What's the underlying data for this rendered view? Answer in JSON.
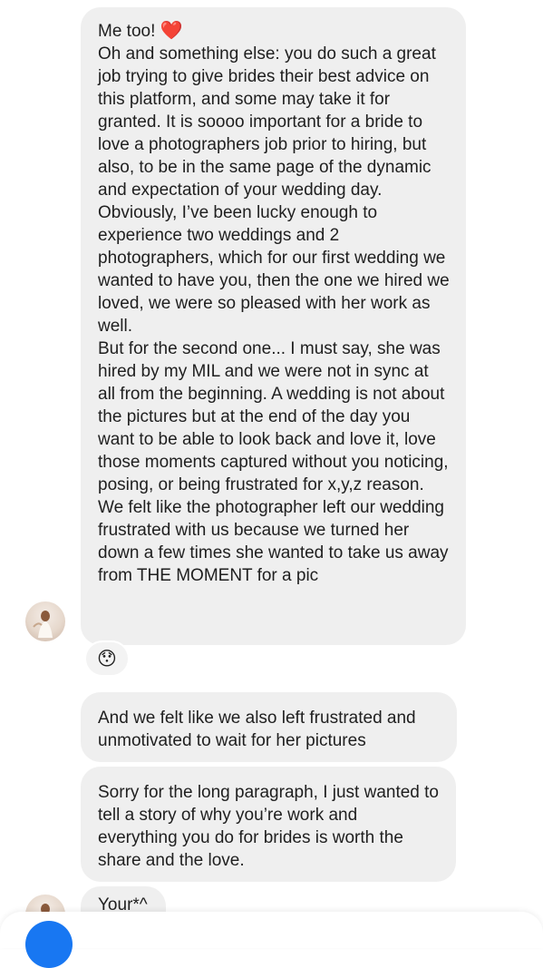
{
  "messages": [
    {
      "first_line": "Me too! ",
      "emoji": "❤️",
      "body": "Oh and something else: you do such a great job trying to give brides their best advice on this platform, and some may take it for granted. It is soooo important for a bride to love a photographers job prior to hiring, but also, to be in the same page of the dynamic and expectation of your wedding day.\nObviously, I’ve been lucky enough to experience two weddings and 2 photographers, which for our first wedding we wanted to have you, then the one we hired we loved, we were so pleased with her work as well.\nBut for the second one... I must say, she was hired by my MIL and we were not in sync at all from the beginning. A wedding is not about the pictures but at the end of the day you want to be able to look back and love it, love those moments captured without you noticing, posing, or being frustrated for x,y,z reason. We felt like the photographer left our wedding frustrated with us because we turned her down a few times she wanted to take us away from THE MOMENT for a pic",
      "reaction": "😯"
    },
    {
      "text": "And we felt like we also left frustrated and unmotivated to wait for her pictures"
    },
    {
      "text": "Sorry for the long paragraph, I just wanted to tell a story of why you’re work and everything you do for brides is worth the share and the love."
    },
    {
      "text": "Your*^"
    }
  ]
}
